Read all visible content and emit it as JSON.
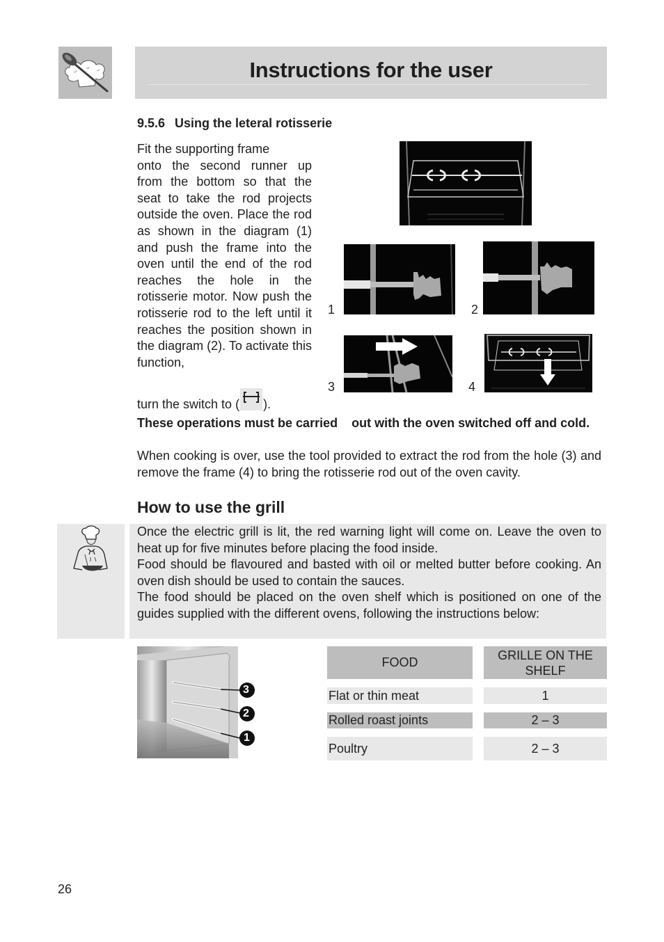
{
  "header": {
    "title": "Instructions for the user",
    "logo_icon": "chef-hat-spoon-icon"
  },
  "section": {
    "number": "9.5.6",
    "title": "Using the leteral rotisserie",
    "intro_paragraph": "Fit the supporting frame onto the second runner up from the bottom so that the seat to take the rod projects outside the oven. Place the rod as shown in the diagram (1) and push the frame into the oven until the end of the rod reaches the hole in the rotisserie motor. Now push the rotisserie rod to the left until it reaches the position shown in the diagram (2). To activate this function,",
    "intro_first_line": "Fit the supporting frame",
    "intro_rest": "onto the second runner up from the bottom so that the seat to take the rod projects outside the oven. Place the rod as shown in the diagram (1) and push the frame into the oven until the end of the rod reaches the hole in the rotisserie motor. Now push the rotisserie rod to the left until it reaches the position shown in the diagram (2). To activate this function,",
    "switch_prefix": "turn the switch to (",
    "switch_suffix": ").",
    "switch_icon": "rotisserie-symbol-icon",
    "warning": "These operations must be carried    out with the oven switched off and cold.",
    "after_text": "When cooking is over, use the tool provided to extract the rod from the hole (3) and remove the frame (4) to bring the rotisserie rod out of the oven cavity.",
    "figures": [
      {
        "label": "",
        "description": "oven with rotisserie frame and rod"
      },
      {
        "label": "1",
        "description": "rod end before hole"
      },
      {
        "label": "2",
        "description": "rod pushed into position"
      },
      {
        "label": "3",
        "description": "extracting rod with arrow right"
      },
      {
        "label": "4",
        "description": "removing frame with arrow down"
      }
    ]
  },
  "grill": {
    "heading": "How to use the grill",
    "chef_icon": "chef-cooking-icon",
    "paragraphs": [
      "Once the electric grill is lit, the red warning light will come on. Leave the oven to heat up for five minutes before placing the food inside.",
      "Food should be flavoured and basted with oil or melted butter before cooking. An oven dish should be used to contain the sauces.",
      "The food should be placed on the oven shelf which is positioned on one of the guides supplied with the different ovens, following the instructions below:"
    ],
    "shelf_figure_labels": [
      "3",
      "2",
      "1"
    ],
    "table": {
      "headers": [
        "FOOD",
        "GRILLE ON THE SHELF"
      ],
      "rows": [
        {
          "food": "Flat or thin meat",
          "shelf": "1"
        },
        {
          "food": "Rolled roast joints",
          "shelf": "2 – 3"
        },
        {
          "food": "Poultry",
          "shelf": "2 – 3"
        }
      ]
    }
  },
  "footer": {
    "page_number": "26"
  }
}
